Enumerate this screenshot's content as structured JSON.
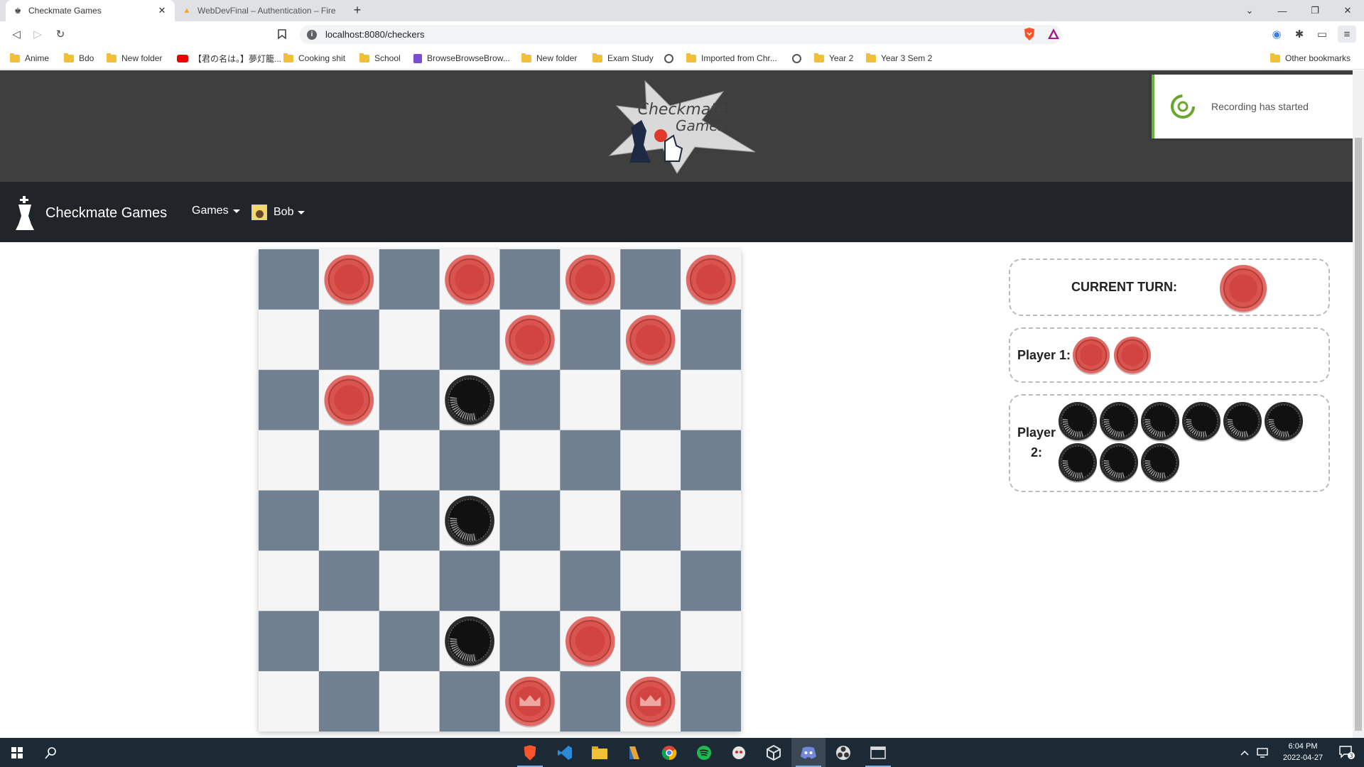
{
  "browser": {
    "tabs": [
      {
        "title": "Checkmate Games",
        "active": true
      },
      {
        "title": "WebDevFinal – Authentication – Fireba",
        "active": false
      }
    ],
    "new_tab": "+",
    "url": "localhost:8080/checkers",
    "bookmarks": [
      {
        "label": "Anime",
        "icon": "folder-icon"
      },
      {
        "label": "Bdo",
        "icon": "folder-icon"
      },
      {
        "label": "New folder",
        "icon": "folder-icon"
      },
      {
        "label": "【君の名は。】夢灯籠...",
        "icon": "youtube-icon"
      },
      {
        "label": "Cooking shit",
        "icon": "folder-icon"
      },
      {
        "label": "School",
        "icon": "folder-icon"
      },
      {
        "label": "BrowseBrowseBrow...",
        "icon": "twitch-icon"
      },
      {
        "label": "New folder",
        "icon": "folder-icon"
      },
      {
        "label": "Exam Study",
        "icon": "folder-icon"
      },
      {
        "label": "",
        "icon": "globe-icon"
      },
      {
        "label": "Imported from Chr...",
        "icon": "folder-icon"
      },
      {
        "label": "",
        "icon": "globe-icon"
      },
      {
        "label": "Year 2",
        "icon": "folder-icon"
      },
      {
        "label": "Year 3 Sem 2",
        "icon": "folder-icon"
      }
    ],
    "other_bookmarks": "Other bookmarks"
  },
  "header": {
    "logo_line1": "Checkmate",
    "logo_line2": "Games"
  },
  "nav": {
    "brand": "Checkmate Games",
    "games": "Games",
    "user": "Bob"
  },
  "board": {
    "rows": 8,
    "cols": 8,
    "dark_color": "#708090",
    "light_color": "#f5f5f5",
    "pieces": [
      {
        "row": 0,
        "col": 1,
        "color": "red",
        "king": false
      },
      {
        "row": 0,
        "col": 3,
        "color": "red",
        "king": false
      },
      {
        "row": 0,
        "col": 5,
        "color": "red",
        "king": false
      },
      {
        "row": 0,
        "col": 7,
        "color": "red",
        "king": false
      },
      {
        "row": 1,
        "col": 4,
        "color": "red",
        "king": false
      },
      {
        "row": 1,
        "col": 6,
        "color": "red",
        "king": false
      },
      {
        "row": 2,
        "col": 1,
        "color": "red",
        "king": false
      },
      {
        "row": 2,
        "col": 3,
        "color": "black",
        "king": false
      },
      {
        "row": 4,
        "col": 3,
        "color": "black",
        "king": false
      },
      {
        "row": 6,
        "col": 3,
        "color": "black",
        "king": false
      },
      {
        "row": 6,
        "col": 5,
        "color": "red",
        "king": false
      },
      {
        "row": 7,
        "col": 4,
        "color": "red",
        "king": true
      },
      {
        "row": 7,
        "col": 6,
        "color": "red",
        "king": true
      }
    ]
  },
  "status": {
    "current_turn_label": "CURRENT TURN:",
    "current_turn_color": "red",
    "player1_label": "Player 1:",
    "player1_captured": 2,
    "player1_captured_color": "red",
    "player2_label_line1": "Player",
    "player2_label_line2": "2:",
    "player2_captured": 9,
    "player2_captured_color": "black"
  },
  "notification": {
    "text": "Recording has started"
  },
  "taskbar": {
    "time": "6:04 PM",
    "date": "2022-04-27",
    "notification_count": "3"
  },
  "colors": {
    "red_piece": "#d9534f",
    "black_piece": "#111111",
    "navbar": "#212529",
    "header": "#3f3f3f"
  }
}
